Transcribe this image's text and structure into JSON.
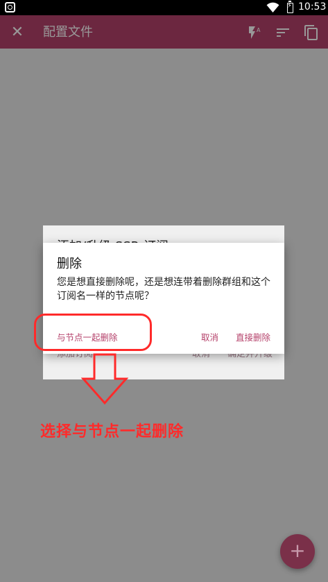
{
  "status_bar": {
    "time": "10:53",
    "icons": [
      "app-icon",
      "wifi-icon",
      "battery-charging-icon"
    ]
  },
  "app_bar": {
    "title": "配置文件",
    "icons": [
      "close-icon",
      "flash-auto-icon",
      "sort-icon",
      "copy-icon"
    ],
    "color": "#b5426b"
  },
  "background_dialog": {
    "title": "添加/升级 SSR 订阅",
    "left_button": "添加订阅",
    "cancel_button": "取消",
    "confirm_button": "确定并升级"
  },
  "dialog": {
    "title": "删除",
    "message": "您是想直接删除呢，还是想连带着删除群组和这个订阅名一样的节点呢？",
    "btn_delete_with_nodes": "与节点一起删除",
    "btn_cancel": "取消",
    "btn_delete_direct": "直接删除",
    "accent_color": "#b5426b"
  },
  "annotation": {
    "text": "选择与节点一起删除",
    "color": "#ff2a2a"
  },
  "fab": {
    "label": "+"
  }
}
